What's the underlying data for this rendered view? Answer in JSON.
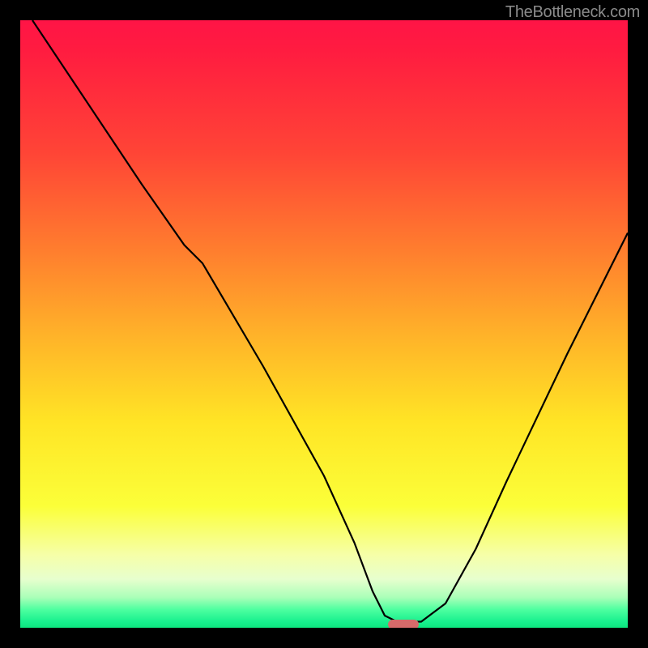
{
  "watermark": "TheBottleneck.com",
  "chart_data": {
    "type": "line",
    "title": "",
    "xlabel": "",
    "ylabel": "",
    "xlim": [
      0,
      100
    ],
    "ylim": [
      0,
      100
    ],
    "series": [
      {
        "name": "bottleneck-curve",
        "x": [
          2,
          10,
          20,
          27,
          30,
          40,
          50,
          55,
          58,
          60,
          62,
          66,
          70,
          75,
          80,
          90,
          100
        ],
        "y": [
          100,
          88,
          73,
          63,
          60,
          43,
          25,
          14,
          6,
          2,
          1,
          1,
          4,
          13,
          24,
          45,
          65
        ]
      }
    ],
    "marker": {
      "x": 63,
      "y": 0.5,
      "label": "optimal-point"
    },
    "background_gradient": {
      "stops": [
        {
          "pos": 0,
          "color": "#ff1446"
        },
        {
          "pos": 22,
          "color": "#ff4536"
        },
        {
          "pos": 38,
          "color": "#ff7e2e"
        },
        {
          "pos": 52,
          "color": "#ffb329"
        },
        {
          "pos": 66,
          "color": "#ffe425"
        },
        {
          "pos": 80,
          "color": "#fbff39"
        },
        {
          "pos": 92,
          "color": "#e7ffce"
        },
        {
          "pos": 100,
          "color": "#0de67f"
        }
      ]
    }
  }
}
